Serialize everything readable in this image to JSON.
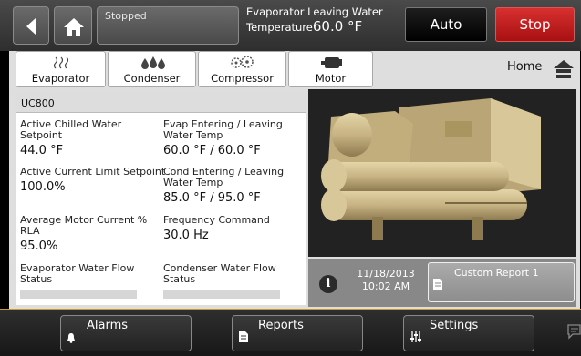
{
  "topbar": {
    "status": "Stopped",
    "evap_line1": "Evaporator Leaving Water",
    "evap_line2": "Temperature",
    "evap_value": "60.0 °F",
    "auto_label": "Auto",
    "stop_label": "Stop"
  },
  "tabs": [
    {
      "label": "Evaporator",
      "icon": "heat-waves-icon"
    },
    {
      "label": "Condenser",
      "icon": "water-drops-icon"
    },
    {
      "label": "Compressor",
      "icon": "gears-icon"
    },
    {
      "label": "Motor",
      "icon": "motor-icon"
    }
  ],
  "home_label": "Home",
  "panel": {
    "title": "UC800",
    "cells": [
      {
        "label": "Active Chilled Water Setpoint",
        "value": "44.0 °F"
      },
      {
        "label": "Evap Entering / Leaving Water Temp",
        "value": "60.0 °F / 60.0 °F"
      },
      {
        "label": "Active Current Limit Setpoint",
        "value": "100.0%"
      },
      {
        "label": "Cond Entering / Leaving Water Temp",
        "value": "85.0 °F / 95.0 °F"
      },
      {
        "label": "Average Motor Current % RLA",
        "value": "95.0%"
      },
      {
        "label": "Frequency Command",
        "value": "30.0 Hz"
      },
      {
        "label": "Evaporator Water Flow Status",
        "value": ""
      },
      {
        "label": "Condenser Water Flow Status",
        "value": ""
      }
    ]
  },
  "info": {
    "date": "11/18/2013",
    "time": "10:02 AM",
    "report_label": "Custom Report 1"
  },
  "bottom": {
    "alarms": "Alarms",
    "reports": "Reports",
    "settings": "Settings"
  },
  "colors": {
    "stop": "#c1181c",
    "accent": "#c29a2d",
    "chiller": "#c7b383"
  }
}
